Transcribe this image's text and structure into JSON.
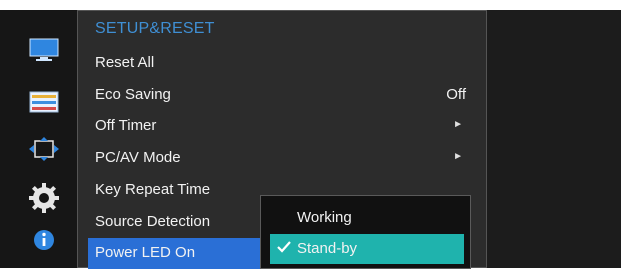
{
  "menu": {
    "title": "SETUP&RESET",
    "items": [
      {
        "label": "Reset All",
        "value": "",
        "has_submenu": false
      },
      {
        "label": "Eco Saving",
        "value": "Off",
        "has_submenu": false
      },
      {
        "label": "Off Timer",
        "value": "",
        "has_submenu": true
      },
      {
        "label": "PC/AV Mode",
        "value": "",
        "has_submenu": true
      },
      {
        "label": "Key Repeat Time",
        "value": "",
        "has_submenu": false
      },
      {
        "label": "Source Detection",
        "value": "",
        "has_submenu": false
      },
      {
        "label": "Power LED On",
        "value": "",
        "has_submenu": false,
        "selected": true
      }
    ]
  },
  "submenu": {
    "options": [
      {
        "label": "Working",
        "selected": false
      },
      {
        "label": "Stand-by",
        "selected": true
      }
    ]
  },
  "icons": [
    "picture-icon",
    "color-icon",
    "size-position-icon",
    "setup-reset-icon",
    "information-icon"
  ],
  "colors": {
    "title": "#3f8fd4",
    "selected_row": "#2a6fd6",
    "selected_option": "#1fb3ad",
    "menu_bg": "#2c2c2c"
  }
}
